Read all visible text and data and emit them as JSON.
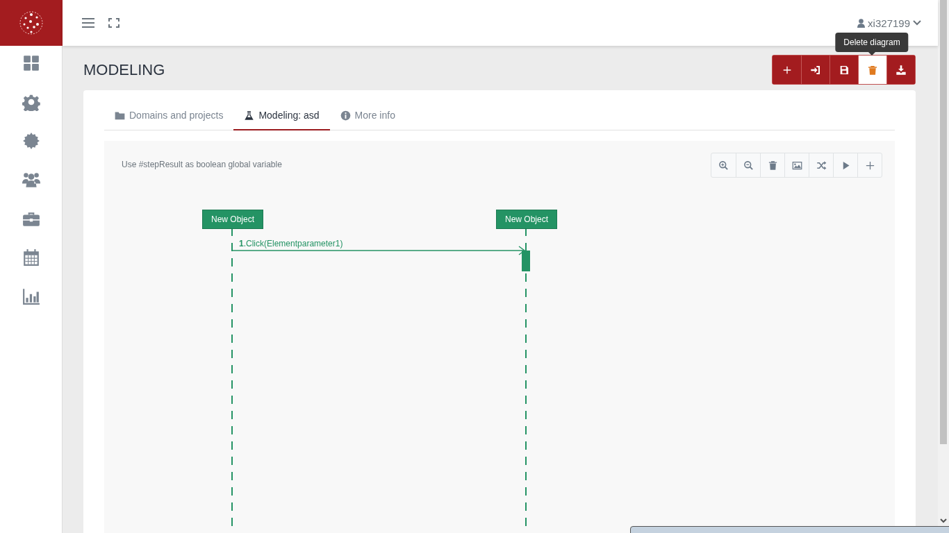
{
  "header": {
    "user": "xi327199"
  },
  "page_title": "MODELING",
  "actions": [
    {
      "kind": "add",
      "hovered": false
    },
    {
      "kind": "import",
      "hovered": false
    },
    {
      "kind": "save",
      "hovered": false
    },
    {
      "kind": "delete",
      "hovered": true,
      "tooltip": "Delete diagram"
    },
    {
      "kind": "download",
      "hovered": false
    }
  ],
  "tabs": [
    {
      "label": "Domains and projects",
      "kind": "folder",
      "selected": false
    },
    {
      "label": "Modeling: asd",
      "kind": "flask",
      "selected": true
    },
    {
      "label": "More info",
      "kind": "info",
      "selected": false
    }
  ],
  "hint": "Use #stepResult as boolean global variable",
  "tools": [
    {
      "kind": "zoom-in"
    },
    {
      "kind": "zoom-out"
    },
    {
      "kind": "trash"
    },
    {
      "kind": "image"
    },
    {
      "kind": "shuffle"
    },
    {
      "kind": "play"
    },
    {
      "kind": "plus"
    }
  ],
  "diagram": {
    "objects": [
      {
        "label": "New Object"
      },
      {
        "label": "New Object"
      }
    ],
    "messages": [
      {
        "text": "**1**.Click(Elementparameter1)"
      }
    ]
  }
}
